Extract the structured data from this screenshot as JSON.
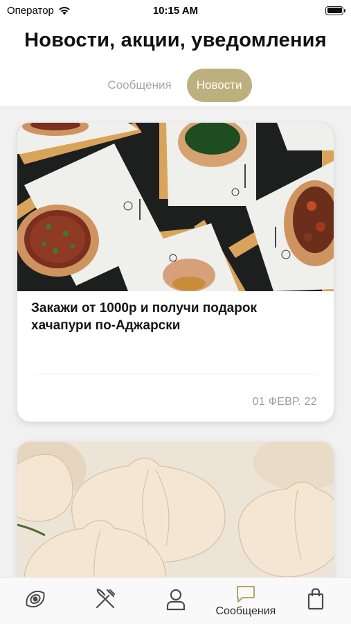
{
  "status_bar": {
    "carrier": "Оператор",
    "time": "10:15 AM"
  },
  "header": {
    "title": "Новости, акции, уведомления",
    "tabs": [
      {
        "label": "Сообщения",
        "active": false
      },
      {
        "label": "Новости",
        "active": true
      }
    ]
  },
  "feed": {
    "cards": [
      {
        "title": "Закажи от 1000р и получи подарок хачапури по-Аджарски",
        "date": "01 ФЕВР. 22",
        "image": "khachapuri-photo"
      },
      {
        "title": "",
        "date": "",
        "image": "khinkali-photo"
      }
    ]
  },
  "tab_bar": {
    "items": [
      {
        "icon": "khachapuri-icon",
        "label": ""
      },
      {
        "icon": "fork-knife-icon",
        "label": ""
      },
      {
        "icon": "profile-icon",
        "label": ""
      },
      {
        "icon": "message-icon",
        "label": "Сообщения",
        "active": true
      },
      {
        "icon": "bag-icon",
        "label": ""
      }
    ]
  },
  "colors": {
    "accent": "#bdb07f",
    "background": "#f1f1f1",
    "tab_icon": "#4a4a4a",
    "active_icon": "#b5a46a"
  }
}
